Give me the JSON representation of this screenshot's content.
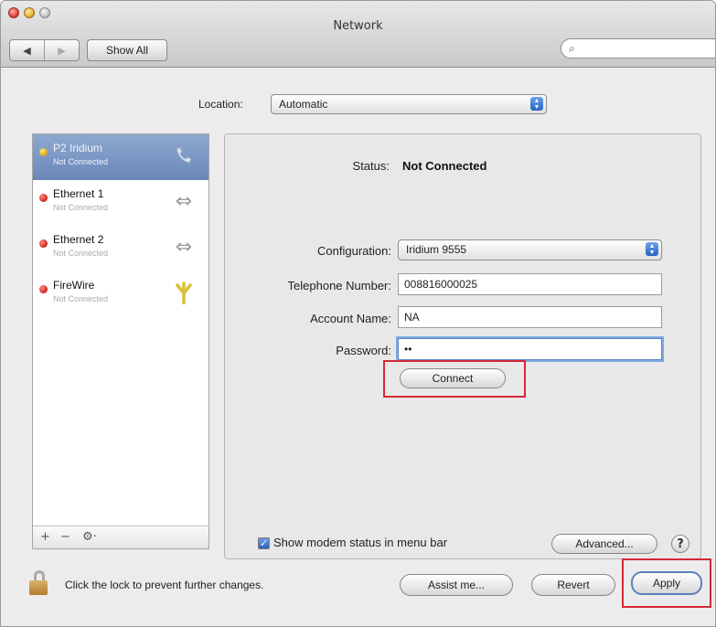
{
  "window": {
    "title": "Network"
  },
  "toolbar": {
    "back": "◀",
    "forward": "▶",
    "show_all": "Show All",
    "search_icon": "magnifying-glass-icon",
    "search_placeholder": ""
  },
  "location": {
    "label": "Location:",
    "value": "Automatic"
  },
  "services": [
    {
      "name": "P2 Iridium",
      "status": "Not Connected",
      "indicator": "yellow",
      "icon": "phone-icon",
      "selected": true
    },
    {
      "name": "Ethernet 1",
      "status": "Not Connected",
      "indicator": "red",
      "icon": "ethernet-arrows-icon"
    },
    {
      "name": "Ethernet 2",
      "status": "Not Connected",
      "indicator": "red",
      "icon": "ethernet-arrows-icon"
    },
    {
      "name": "FireWire",
      "status": "Not Connected",
      "indicator": "red",
      "icon": "firewire-icon"
    }
  ],
  "sidebar_tools": {
    "add": "+",
    "remove": "−",
    "action": "⚙·"
  },
  "detail": {
    "status_label": "Status:",
    "status_value": "Not Connected",
    "configuration_label": "Configuration:",
    "configuration_value": "Iridium 9555",
    "telephone_label": "Telephone Number:",
    "telephone_value": "008816000025",
    "account_label": "Account Name:",
    "account_value": "NA",
    "password_label": "Password:",
    "password_value": "••",
    "connect": "Connect",
    "show_modem_status": "Show modem status in menu bar",
    "show_modem_checked": true,
    "advanced": "Advanced...",
    "help": "?"
  },
  "footer": {
    "lock_text": "Click the lock to prevent further changes.",
    "assist": "Assist me...",
    "revert": "Revert",
    "apply": "Apply"
  },
  "colors": {
    "highlight_box": "#d42a36",
    "selection": "#7690c0"
  }
}
